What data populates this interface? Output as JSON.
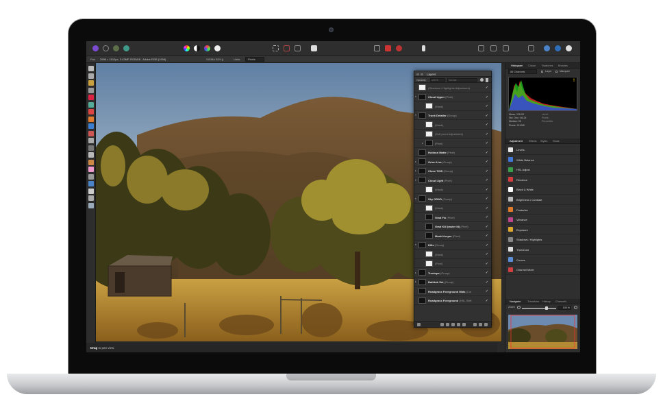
{
  "device": {
    "name": "MacBook Pro"
  },
  "colors": {
    "accent": "#4b83c9",
    "affinity_brand": "#7b4bcf",
    "panel_bg": "#313131",
    "check": "#e8e8e8"
  },
  "toolbar": {
    "personas": [
      "photo-persona-icon",
      "liquify-persona-icon",
      "develop-persona-icon",
      "tone-map-persona-icon",
      "export-persona-icon"
    ],
    "center_icons": [
      "color-wheel-icon",
      "levels-icon",
      "hsl-icon",
      "white-balance-icon"
    ],
    "mid_icons": [
      "marquee-icon",
      "freehand-icon",
      "mask-icon",
      "quick-mask-icon"
    ],
    "right_icons": [
      "grid-icon",
      "flag-icon",
      "brush-icon",
      "assistant-icon",
      "snapping-icon",
      "arrange-icon",
      "view-icon",
      "studio-icon"
    ]
  },
  "context_toolbar": {
    "tool": "Pan",
    "image_info": "2996 × 1512px, 3.43MP, RGBA/8 - Adobe RGB (1998)",
    "camera": "SIGMA SD9 ()",
    "units_label": "Units:",
    "units_value": "Pixels"
  },
  "tools": [
    "move-tool-icon",
    "crop-tool-icon",
    "selection-brush-icon",
    "marquee-tool-icon",
    "flood-select-icon",
    "color-picker-icon",
    "paint-brush-icon",
    "erase-brush-icon",
    "fill-tool-icon",
    "gradient-tool-icon",
    "dodge-tool-icon",
    "burn-tool-icon",
    "sponge-tool-icon",
    "clone-tool-icon",
    "healing-tool-icon",
    "patch-tool-icon",
    "shape-tool-icon",
    "text-tool-icon",
    "view-tool-icon",
    "zoom-tool-icon"
  ],
  "status_bar": {
    "bold": "Drag",
    "rest": "to pan view."
  },
  "layers_panel": {
    "title": "Layers",
    "opacity_label": "Opacity:",
    "opacity_value": "100 %",
    "blend_mode": "Normal",
    "rows": [
      {
        "name": "(Shadows / Highlights Adjustment)",
        "kind": "",
        "indent": 0,
        "faded": true,
        "arrow": ""
      },
      {
        "name": "Cloud Upper",
        "kind": "(Pixel)",
        "indent": 0,
        "arrow": "▾"
      },
      {
        "name": "(Mask)",
        "kind": "",
        "indent": 1,
        "faded": true,
        "arrow": ""
      },
      {
        "name": "Trunk Detailer",
        "kind": "(Group)",
        "indent": 0,
        "arrow": "▾"
      },
      {
        "name": "(Mask)",
        "kind": "",
        "indent": 1,
        "faded": true,
        "arrow": ""
      },
      {
        "name": "(Soft proof Adjustment)",
        "kind": "",
        "indent": 1,
        "faded": true,
        "arrow": ""
      },
      {
        "name": "",
        "kind": "(Pixel)",
        "indent": 1,
        "arrow": "▸"
      },
      {
        "name": "Holdout Matte",
        "kind": "(Pixel)",
        "indent": 0,
        "arrow": ""
      },
      {
        "name": "Orion Live",
        "kind": "(Group)",
        "indent": 0,
        "arrow": "▸"
      },
      {
        "name": "Clone THIS",
        "kind": "(Group)",
        "indent": 0,
        "arrow": "▸"
      },
      {
        "name": "Cloud Light",
        "kind": "(Pixel)",
        "indent": 0,
        "arrow": "▾"
      },
      {
        "name": "(Mask)",
        "kind": "",
        "indent": 1,
        "faded": true,
        "arrow": ""
      },
      {
        "name": "Sky GRAD",
        "kind": "(Group)",
        "indent": 0,
        "arrow": "▾"
      },
      {
        "name": "(Mask)",
        "kind": "",
        "indent": 1,
        "faded": true,
        "arrow": ""
      },
      {
        "name": "Grad Fix",
        "kind": "(Pixel)",
        "indent": 1,
        "arrow": ""
      },
      {
        "name": "Grad Kill (raster lit)",
        "kind": "(Pixel)",
        "indent": 1,
        "arrow": ""
      },
      {
        "name": "Mask Keeper",
        "kind": "(Pixel)",
        "indent": 1,
        "arrow": ""
      },
      {
        "name": "Hills",
        "kind": "(Group)",
        "indent": 0,
        "arrow": "▾"
      },
      {
        "name": "(Mask)",
        "kind": "",
        "indent": 1,
        "faded": true,
        "arrow": ""
      },
      {
        "name": "(Pixel)",
        "kind": "",
        "indent": 1,
        "faded": true,
        "arrow": ""
      },
      {
        "name": "Treetops",
        "kind": "(Group)",
        "indent": 0,
        "arrow": "▸"
      },
      {
        "name": "Bathtub Set",
        "kind": "(Group)",
        "indent": 0,
        "arrow": "▸"
      },
      {
        "name": "Roadgrass Foreground Mids",
        "kind": "(Cur",
        "indent": 0,
        "arrow": ""
      },
      {
        "name": "Roadgrass Foreground",
        "kind": "(HSL Shift",
        "indent": 0,
        "arrow": ""
      }
    ]
  },
  "histogram_panel": {
    "tabs": [
      "Histogram",
      "Colour",
      "Swatches",
      "Brushes"
    ],
    "channel": "All Channels",
    "layer_label": "Layer",
    "marquee_label": "Marquee",
    "warning": "!",
    "stats": [
      {
        "label": "Mean: 126.03",
        "right": "Level:"
      },
      {
        "label": "Std. Dev.: 66.24",
        "right": "Pixels:"
      },
      {
        "label": "Median: 95",
        "right": "Percentile:"
      },
      {
        "label": "Pixels: 2143/8",
        "right": ""
      }
    ]
  },
  "adjustment_panel": {
    "tabs": [
      "Adjustment",
      "Effects",
      "Styles",
      "Stock"
    ],
    "items": [
      {
        "label": "Levels",
        "icon": "levels-icon",
        "color": "#e8e8e8"
      },
      {
        "label": "White Balance",
        "icon": "white-balance-icon",
        "color": "#3f78d6"
      },
      {
        "label": "HSL Adjust",
        "icon": "hsl-icon",
        "color": "#39a04a"
      },
      {
        "label": "Recolour",
        "icon": "recolour-icon",
        "color": "#d63d3d"
      },
      {
        "label": "Black & White",
        "icon": "black-white-icon",
        "color": "#ffffff"
      },
      {
        "label": "Brightness / Contrast",
        "icon": "brightness-icon",
        "color": "#bbbbbb"
      },
      {
        "label": "Posterise",
        "icon": "posterise-icon",
        "color": "#e07b2e"
      },
      {
        "label": "Vibrance",
        "icon": "vibrance-icon",
        "color": "#c1448f"
      },
      {
        "label": "Exposure",
        "icon": "exposure-icon",
        "color": "#e0a72e"
      },
      {
        "label": "Shadows / Highlights",
        "icon": "shadows-highlights-icon",
        "color": "#888888"
      },
      {
        "label": "Threshold",
        "icon": "threshold-icon",
        "color": "#dddddd"
      },
      {
        "label": "Curves",
        "icon": "curves-icon",
        "color": "#5a8ed6"
      },
      {
        "label": "Channel Mixer",
        "icon": "channel-mixer-icon",
        "color": "#d04040"
      }
    ]
  },
  "navigator_panel": {
    "tabs": [
      "Navigator",
      "Transform",
      "History",
      "Channels"
    ],
    "zoom_label": "Zoom",
    "zoom_value": "100 %"
  }
}
